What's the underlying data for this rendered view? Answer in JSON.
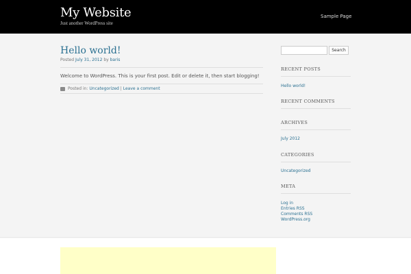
{
  "header": {
    "site_title": "My Website",
    "site_description": "Just another WordPress site",
    "nav": [
      "Sample Page"
    ]
  },
  "post": {
    "title": "Hello world!",
    "meta_prefix": "Posted",
    "date": "July 31, 2012",
    "meta_by": "by",
    "author": "baris",
    "content": "Welcome to WordPress. This is your first post. Edit or delete it, then start blogging!",
    "posted_in_label": "Posted in:",
    "category": "Uncategorized",
    "separator": "|",
    "comment_link": "Leave a comment"
  },
  "sidebar": {
    "search_placeholder": "",
    "search_button": "Search",
    "recent_posts_title": "RECENT POSTS",
    "recent_posts": [
      "Hello world!"
    ],
    "recent_comments_title": "RECENT COMMENTS",
    "archives_title": "ARCHIVES",
    "archives": [
      "July 2012"
    ],
    "categories_title": "CATEGORIES",
    "categories": [
      "Uncategorized"
    ],
    "meta_title": "META",
    "meta_links": [
      "Log in",
      "Entries RSS",
      "Comments RSS",
      "WordPress.org"
    ]
  },
  "colors": {
    "header_bg": "#000000",
    "link": "#2a7091",
    "footer_widget_bg": "#ffffc8"
  }
}
